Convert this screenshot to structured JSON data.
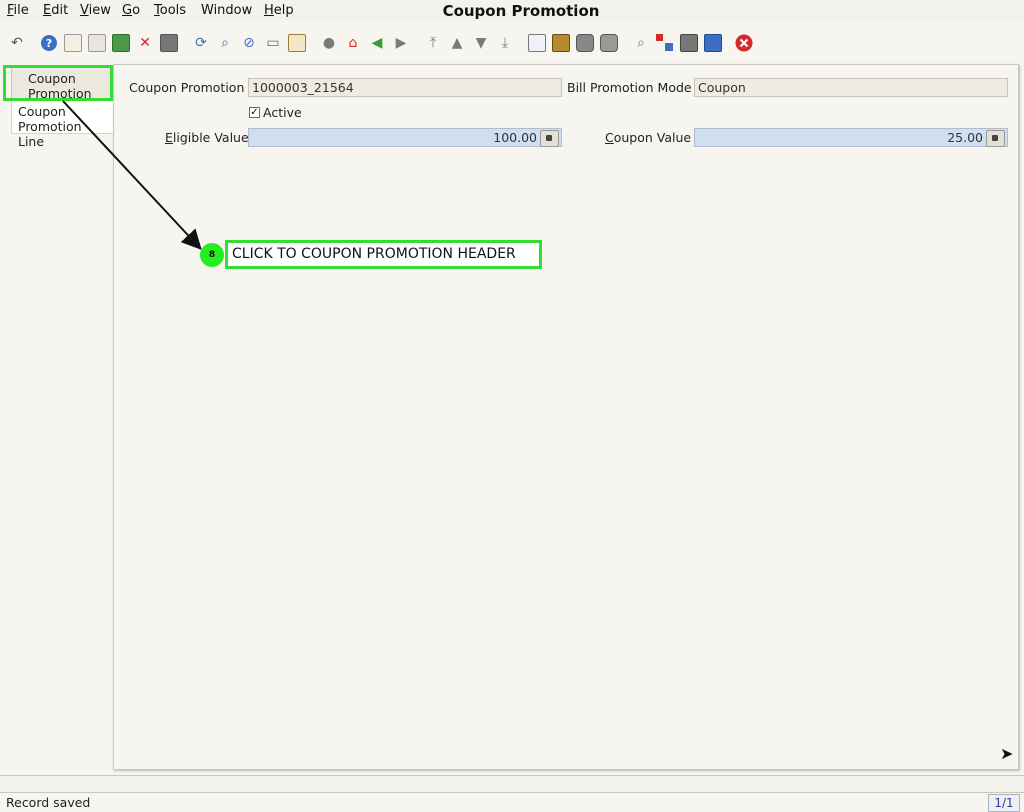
{
  "window": {
    "title": "Coupon Promotion"
  },
  "menubar": {
    "items": [
      {
        "name": "File",
        "u": "F",
        "rest": "ile"
      },
      {
        "name": "Edit",
        "u": "E",
        "rest": "dit"
      },
      {
        "name": "View",
        "u": "V",
        "rest": "iew"
      },
      {
        "name": "Go",
        "u": "G",
        "rest": "o"
      },
      {
        "name": "Tools",
        "u": "T",
        "rest": "ools"
      },
      {
        "name": "Window",
        "u": "",
        "rest": "Window"
      },
      {
        "name": "Help",
        "u": "H",
        "rest": "elp"
      }
    ]
  },
  "toolbar": {
    "icons": [
      "undo-icon",
      "help-icon",
      "new-record-icon",
      "copy-record-icon",
      "save-icon",
      "delete-icon",
      "ignore-icon",
      "refresh-icon",
      "find-icon",
      "attachment-icon",
      "chat-icon",
      "grid-toggle-icon",
      "history-icon",
      "home-icon",
      "back-icon",
      "forward-icon",
      "first-record-icon",
      "previous-record-icon",
      "next-record-icon",
      "last-record-icon",
      "report-icon",
      "archive-icon",
      "print-preview-icon",
      "print-icon",
      "zoom-across-icon",
      "active-workflows-icon",
      "request-icon",
      "product-info-icon",
      "exit-icon"
    ],
    "colors": {
      "blue": "#3b6fc4",
      "red": "#d42a2a",
      "green": "#3a9b3a",
      "gray": "#7a7a7a"
    }
  },
  "tabs": [
    {
      "label_1": "Coupon",
      "label_2": "Promotion",
      "active": true
    },
    {
      "label_1": "Coupon",
      "label_2": "Promotion Line",
      "active": false
    }
  ],
  "form": {
    "coupon_promotion_label": "Coupon Promotion",
    "coupon_promotion_value": "1000003_21564",
    "bill_promotion_mode_label": "Bill Promotion Mode",
    "bill_promotion_mode_value": "Coupon",
    "active_label": "Active",
    "active_checked": true,
    "eligible_value_label_u": "E",
    "eligible_value_label_rest": "ligible Value",
    "eligible_value": "100.00",
    "coupon_value_label_u": "C",
    "coupon_value_label_rest": "oupon Value",
    "coupon_value": "25.00"
  },
  "annotation": {
    "step_number": "8",
    "instruction": "CLICK TO COUPON PROMOTION HEADER",
    "color": "#33dd33"
  },
  "status": {
    "message": "Record saved",
    "record_count": "1/1"
  }
}
